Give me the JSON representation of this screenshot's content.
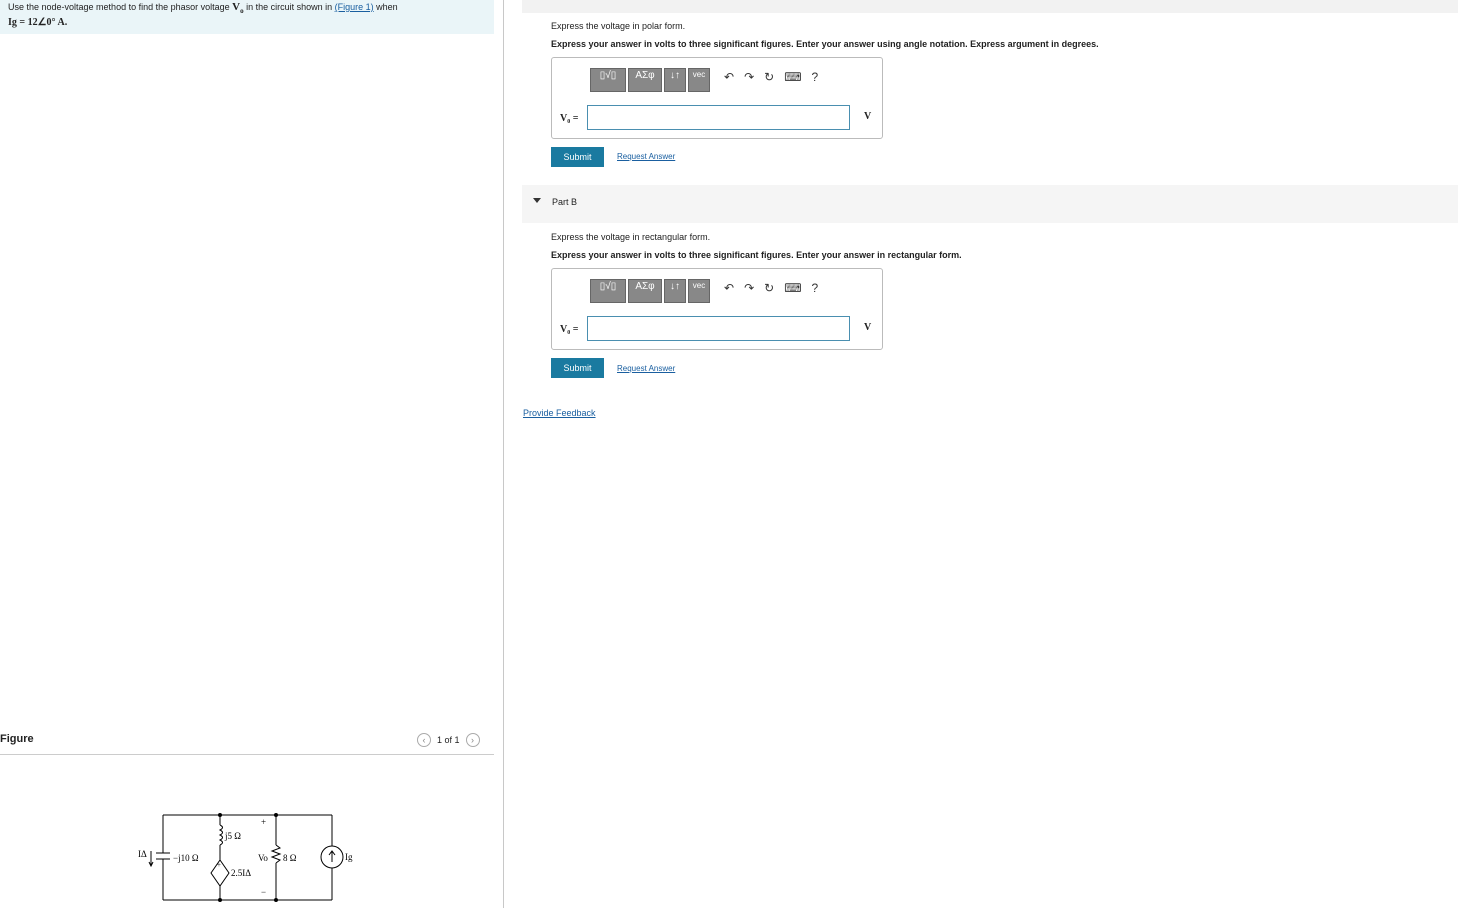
{
  "problem": {
    "text_prefix": "Use the node-voltage method to find the phasor voltage ",
    "var_vo": "V",
    "var_vo_sub": "o",
    "text_mid": " in the circuit shown in ",
    "figure_link": "(Figure 1)",
    "text_suffix": " when",
    "condition": "Ig = 12∠0° A."
  },
  "figure": {
    "title": "Figure",
    "pager_text": "1 of 1",
    "prev_icon": "‹",
    "next_icon": "›",
    "labels": {
      "idelta": "IΔ",
      "cap": "−j10 Ω",
      "ind": "j5 Ω",
      "dep": "2.5IΔ",
      "vo": "Vo",
      "res": "8 Ω",
      "ig": "Ig",
      "plus": "+",
      "minus": "−",
      "dep_plus": "+"
    }
  },
  "partA": {
    "instr1": "Express the voltage in polar form.",
    "instr2": "Express your answer in volts to three significant figures. Enter your answer using angle notation. Express argument in degrees.",
    "var_label": "V₀ =",
    "unit": "V",
    "input_value": "",
    "submit": "Submit",
    "request": "Request Answer"
  },
  "partB": {
    "title": "Part B",
    "instr1": "Express the voltage in rectangular form.",
    "instr2": "Express your answer in volts to three significant figures. Enter your answer in rectangular form.",
    "var_label": "V₀ =",
    "unit": "V",
    "input_value": "",
    "submit": "Submit",
    "request": "Request Answer"
  },
  "toolbar": {
    "templates": "▯√▯",
    "greek": "ΑΣφ",
    "sub": "↓↑",
    "vec": "vec",
    "undo": "↶",
    "redo": "↷",
    "reset": "↻",
    "keyboard": "⌨",
    "help": "?"
  },
  "feedback": "Provide Feedback"
}
